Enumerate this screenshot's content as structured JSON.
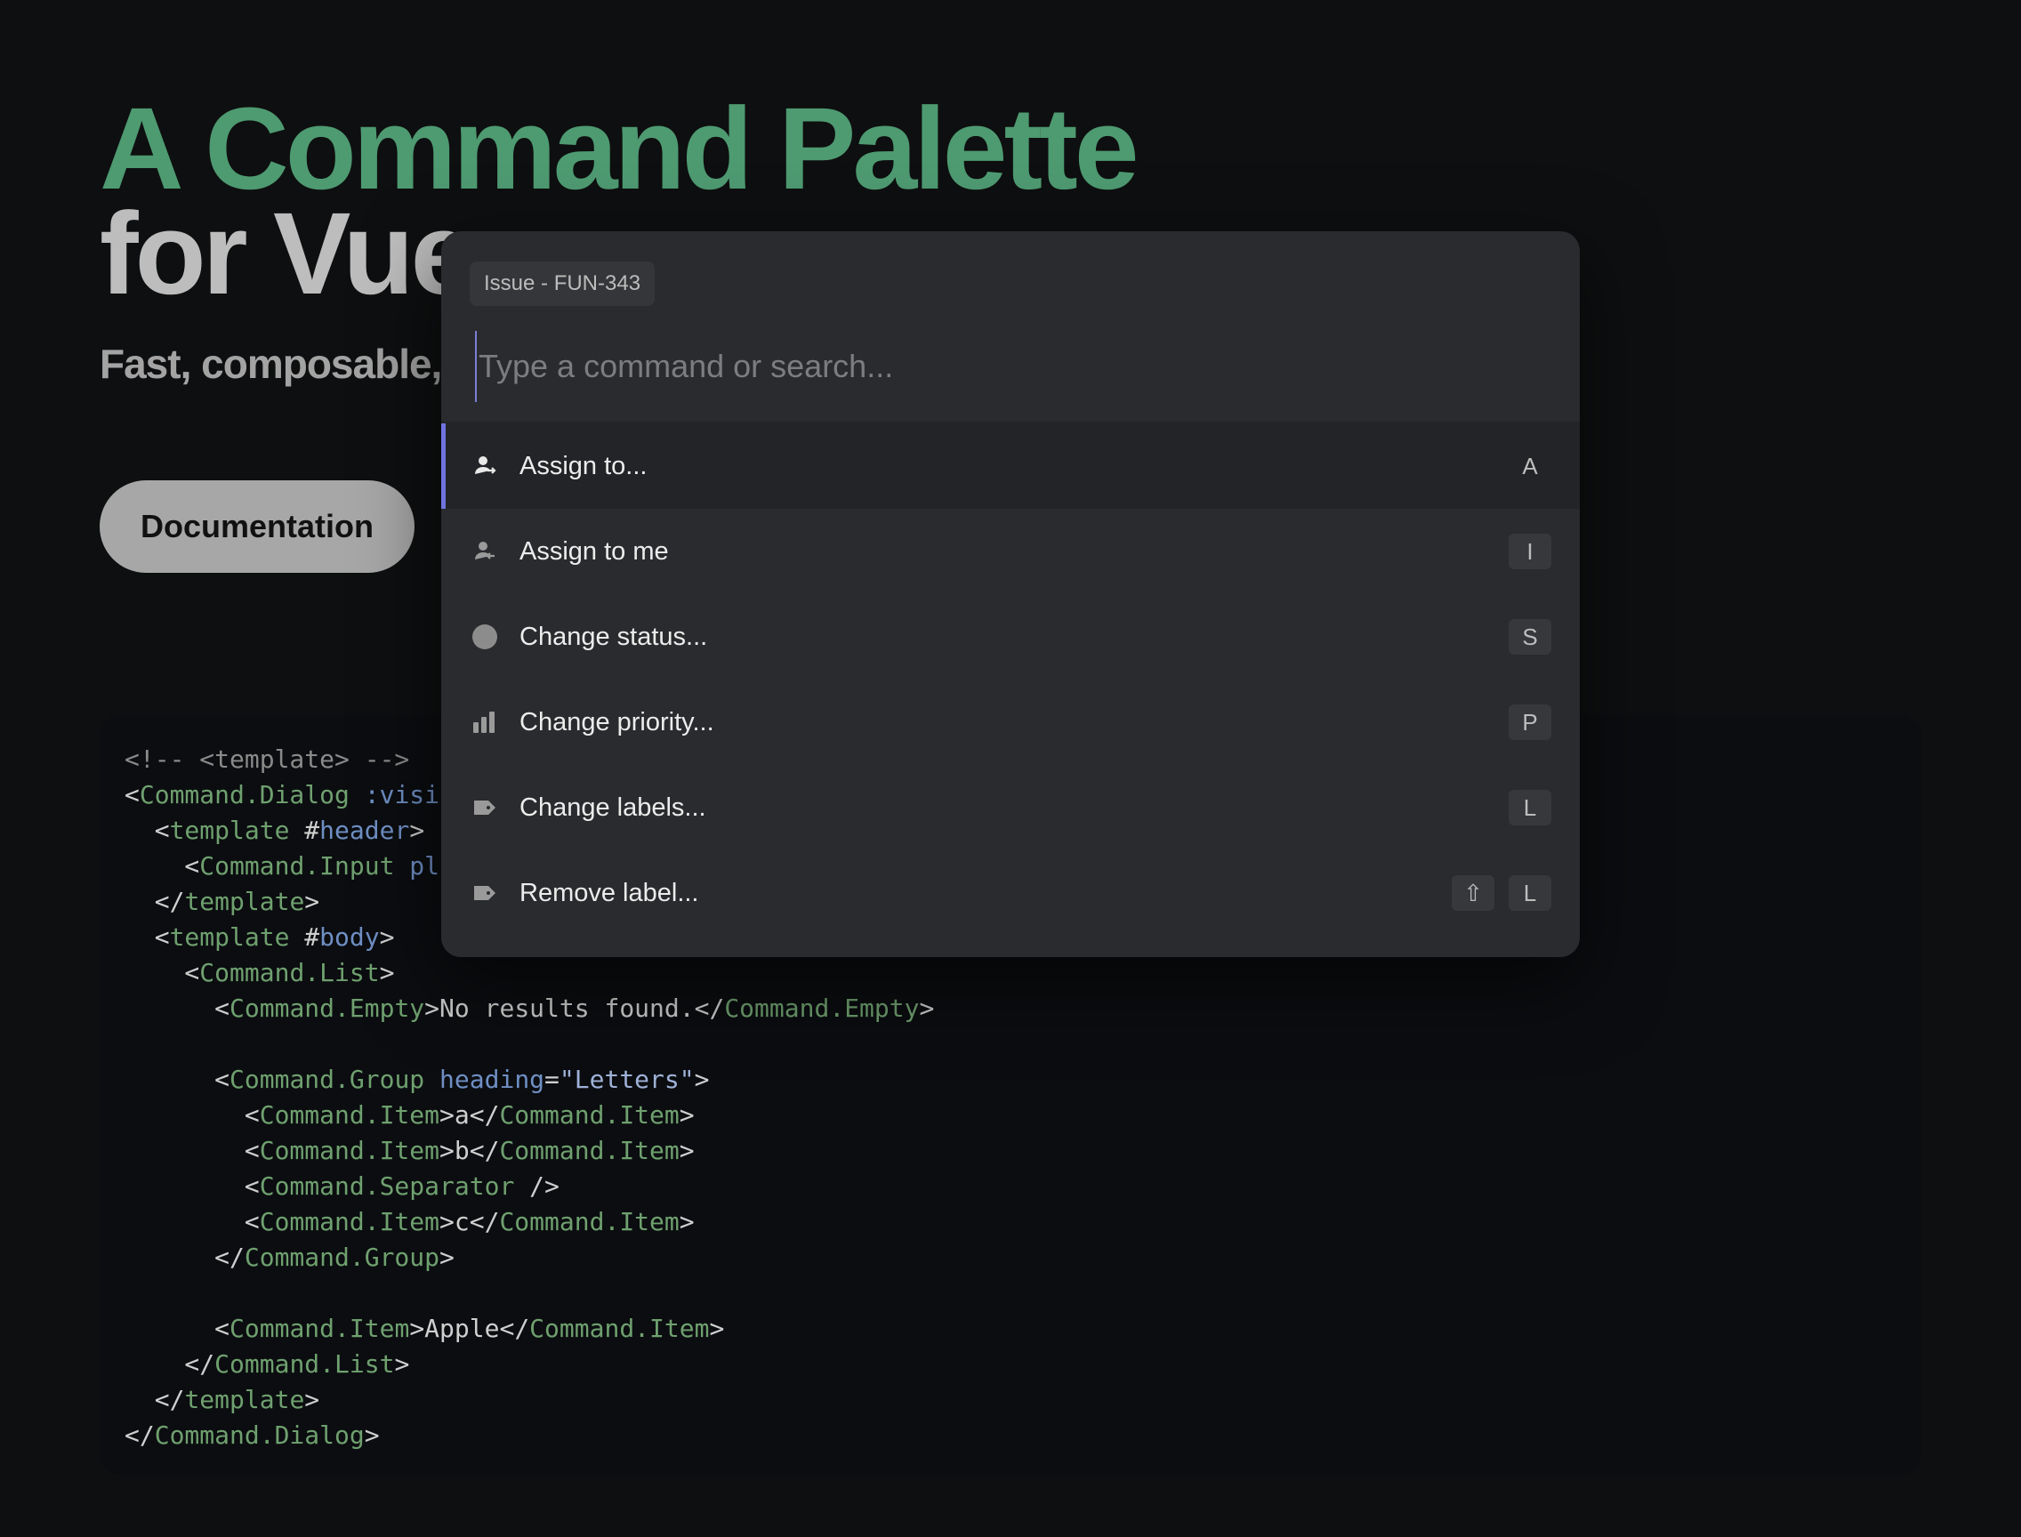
{
  "hero": {
    "title_line1": "A Command Palette",
    "title_line2": "for Vue",
    "subtitle": "Fast, composable,"
  },
  "documentation_button": "Documentation",
  "code": {
    "lines": [
      [
        {
          "t": "<!-- <template> -->",
          "c": "cmt"
        }
      ],
      [
        {
          "t": "<",
          "c": "txt"
        },
        {
          "t": "Command.Dialog",
          "c": "tag"
        },
        {
          "t": " :visi",
          "c": "attr"
        }
      ],
      [
        {
          "t": "  <",
          "c": "txt"
        },
        {
          "t": "template",
          "c": "tag"
        },
        {
          "t": " #",
          "c": "txt"
        },
        {
          "t": "header",
          "c": "attr"
        },
        {
          "t": ">",
          "c": "txt"
        }
      ],
      [
        {
          "t": "    <",
          "c": "txt"
        },
        {
          "t": "Command.Input",
          "c": "tag"
        },
        {
          "t": " pl",
          "c": "attr"
        }
      ],
      [
        {
          "t": "  </",
          "c": "txt"
        },
        {
          "t": "template",
          "c": "tag"
        },
        {
          "t": ">",
          "c": "txt"
        }
      ],
      [
        {
          "t": "  <",
          "c": "txt"
        },
        {
          "t": "template",
          "c": "tag"
        },
        {
          "t": " #",
          "c": "txt"
        },
        {
          "t": "body",
          "c": "attr"
        },
        {
          "t": ">",
          "c": "txt"
        }
      ],
      [
        {
          "t": "    <",
          "c": "txt"
        },
        {
          "t": "Command.List",
          "c": "tag"
        },
        {
          "t": ">",
          "c": "txt"
        }
      ],
      [
        {
          "t": "      <",
          "c": "txt"
        },
        {
          "t": "Command.Empty",
          "c": "tag"
        },
        {
          "t": ">No results found.</",
          "c": "txt"
        },
        {
          "t": "Command.Empty",
          "c": "tag"
        },
        {
          "t": ">",
          "c": "txt"
        }
      ],
      [],
      [
        {
          "t": "      <",
          "c": "txt"
        },
        {
          "t": "Command.Group",
          "c": "tag"
        },
        {
          "t": " heading",
          "c": "attr"
        },
        {
          "t": "=",
          "c": "txt"
        },
        {
          "t": "\"Letters\"",
          "c": "str"
        },
        {
          "t": ">",
          "c": "txt"
        }
      ],
      [
        {
          "t": "        <",
          "c": "txt"
        },
        {
          "t": "Command.Item",
          "c": "tag"
        },
        {
          "t": ">a</",
          "c": "txt"
        },
        {
          "t": "Command.Item",
          "c": "tag"
        },
        {
          "t": ">",
          "c": "txt"
        }
      ],
      [
        {
          "t": "        <",
          "c": "txt"
        },
        {
          "t": "Command.Item",
          "c": "tag"
        },
        {
          "t": ">b</",
          "c": "txt"
        },
        {
          "t": "Command.Item",
          "c": "tag"
        },
        {
          "t": ">",
          "c": "txt"
        }
      ],
      [
        {
          "t": "        <",
          "c": "txt"
        },
        {
          "t": "Command.Separator",
          "c": "tag"
        },
        {
          "t": " />",
          "c": "txt"
        }
      ],
      [
        {
          "t": "        <",
          "c": "txt"
        },
        {
          "t": "Command.Item",
          "c": "tag"
        },
        {
          "t": ">c</",
          "c": "txt"
        },
        {
          "t": "Command.Item",
          "c": "tag"
        },
        {
          "t": ">",
          "c": "txt"
        }
      ],
      [
        {
          "t": "      </",
          "c": "txt"
        },
        {
          "t": "Command.Group",
          "c": "tag"
        },
        {
          "t": ">",
          "c": "txt"
        }
      ],
      [],
      [
        {
          "t": "      <",
          "c": "txt"
        },
        {
          "t": "Command.Item",
          "c": "tag"
        },
        {
          "t": ">Apple</",
          "c": "txt"
        },
        {
          "t": "Command.Item",
          "c": "tag"
        },
        {
          "t": ">",
          "c": "txt"
        }
      ],
      [
        {
          "t": "    </",
          "c": "txt"
        },
        {
          "t": "Command.List",
          "c": "tag"
        },
        {
          "t": ">",
          "c": "txt"
        }
      ],
      [
        {
          "t": "  </",
          "c": "txt"
        },
        {
          "t": "template",
          "c": "tag"
        },
        {
          "t": ">",
          "c": "txt"
        }
      ],
      [
        {
          "t": "</",
          "c": "txt"
        },
        {
          "t": "Command.Dialog",
          "c": "tag"
        },
        {
          "t": ">",
          "c": "txt"
        }
      ]
    ]
  },
  "palette": {
    "issue_badge": "Issue - FUN-343",
    "input_placeholder": "Type a command or search...",
    "accent_color": "#6f74e0",
    "items": [
      {
        "label": "Assign to...",
        "icon": "assign-user-icon",
        "keys": [
          "A"
        ],
        "active": true
      },
      {
        "label": "Assign to me",
        "icon": "assign-self-icon",
        "keys": [
          "I"
        ],
        "active": false
      },
      {
        "label": "Change status...",
        "icon": "status-circle-icon",
        "keys": [
          "S"
        ],
        "active": false
      },
      {
        "label": "Change priority...",
        "icon": "priority-bars-icon",
        "keys": [
          "P"
        ],
        "active": false
      },
      {
        "label": "Change labels...",
        "icon": "label-tag-icon",
        "keys": [
          "L"
        ],
        "active": false
      },
      {
        "label": "Remove label...",
        "icon": "label-tag-icon",
        "keys": [
          "⇧",
          "L"
        ],
        "active": false
      }
    ]
  }
}
